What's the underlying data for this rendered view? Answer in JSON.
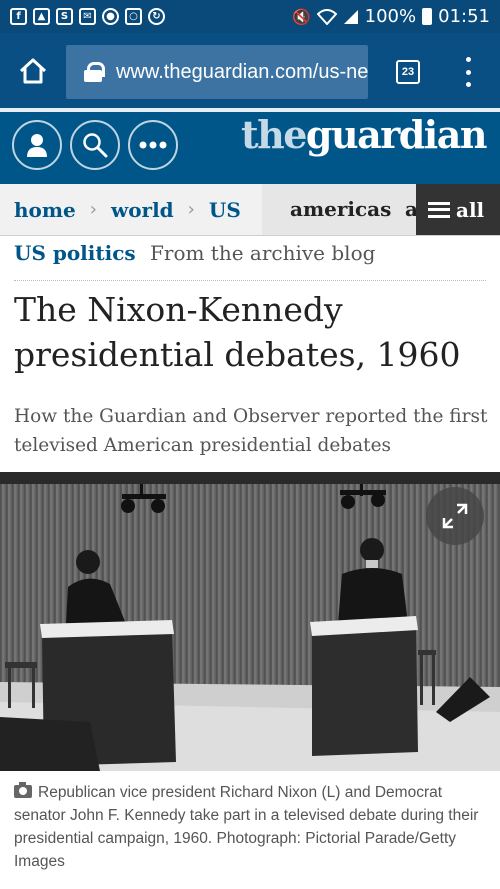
{
  "status_bar": {
    "battery_percent": "100%",
    "time": "01:51"
  },
  "browser": {
    "url": "www.theguardian.com/us-news",
    "tab_count": "23"
  },
  "site": {
    "logo_prefix": "the",
    "logo_main": "guardian"
  },
  "nav": {
    "crumbs": [
      "home",
      "world",
      "US"
    ],
    "next_items": [
      "americas",
      "a"
    ],
    "all_label": "all"
  },
  "article": {
    "section": "US politics",
    "series": "From the archive blog",
    "headline": "The Nixon-Kennedy presidential debates, 1960",
    "standfirst": "How the Guardian and Observer reported the first televised American presidential debates",
    "caption": "Republican vice president Richard Nixon (L) and Democrat senator John F. Kennedy take part in a televised debate during their presidential campaign, 1960. Photograph: Pictorial Parade/Getty Images"
  }
}
